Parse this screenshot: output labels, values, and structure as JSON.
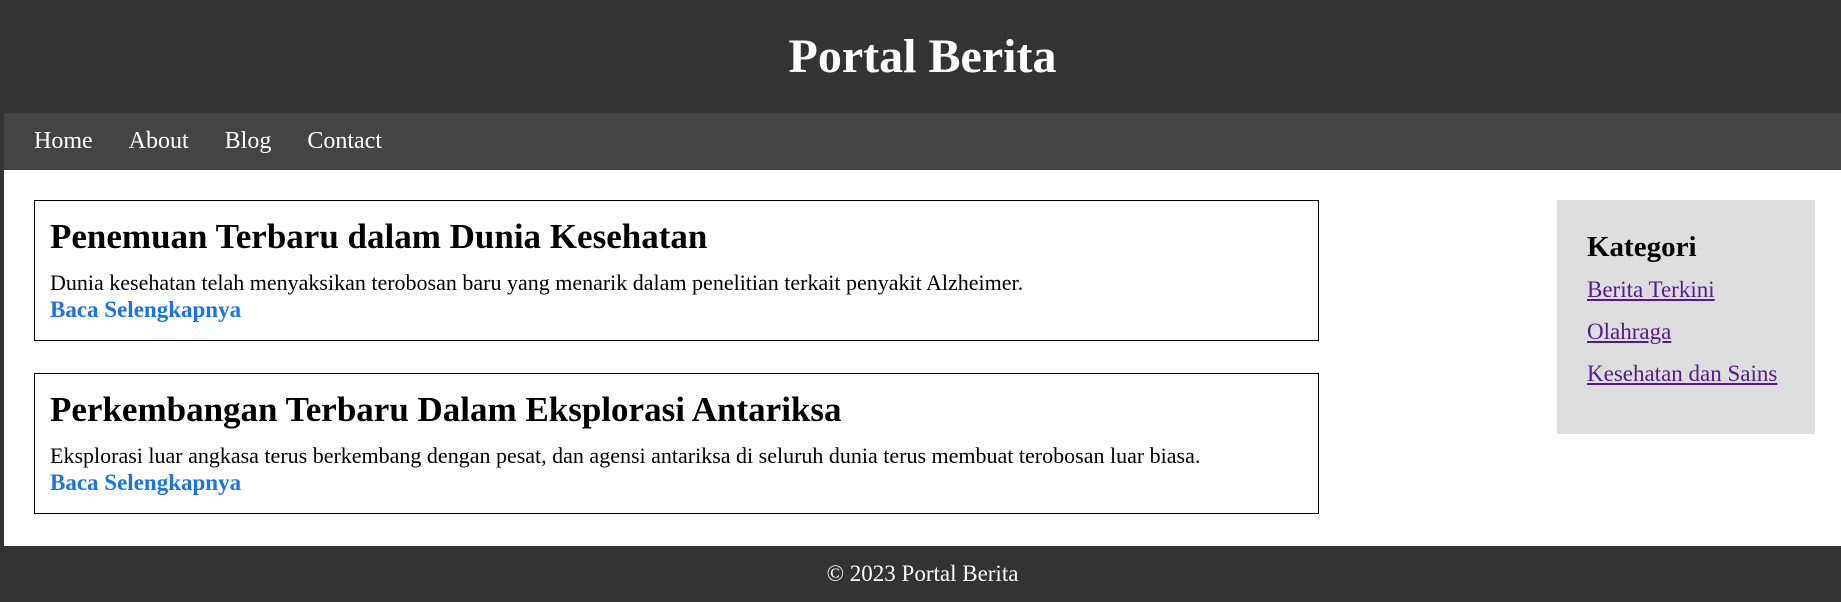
{
  "header": {
    "title": "Portal Berita"
  },
  "nav": {
    "items": [
      {
        "label": "Home"
      },
      {
        "label": "About"
      },
      {
        "label": "Blog"
      },
      {
        "label": "Contact"
      }
    ]
  },
  "articles": [
    {
      "title": "Penemuan Terbaru dalam Dunia Kesehatan",
      "excerpt": "Dunia kesehatan telah menyaksikan terobosan baru yang menarik dalam penelitian terkait penyakit Alzheimer.",
      "link_label": "Baca Selengkapnya"
    },
    {
      "title": "Perkembangan Terbaru Dalam Eksplorasi Antariksa",
      "excerpt": "Eksplorasi luar angkasa terus berkembang dengan pesat, dan agensi antariksa di seluruh dunia terus membuat terobosan luar biasa.",
      "link_label": "Baca Selengkapnya"
    }
  ],
  "sidebar": {
    "title": "Kategori",
    "items": [
      {
        "label": "Berita Terkini"
      },
      {
        "label": "Olahraga"
      },
      {
        "label": "Kesehatan dan Sains"
      }
    ]
  },
  "footer": {
    "text": "© 2023 Portal Berita"
  },
  "colors": {
    "header_bg": "#333333",
    "nav_bg": "#444444",
    "link_blue": "#1a73e8",
    "visited_purple": "#551a8b",
    "sidebar_bg": "#dddddd"
  }
}
